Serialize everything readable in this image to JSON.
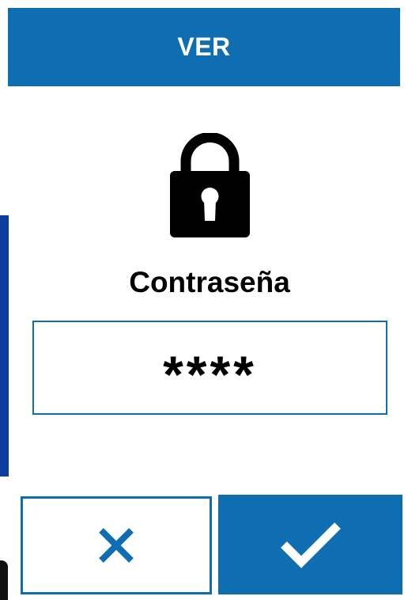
{
  "header": {
    "title": "VER"
  },
  "lock": {
    "icon": "lock-icon"
  },
  "password": {
    "label": "Contraseña",
    "value": "****"
  },
  "actions": {
    "cancel_icon": "close-icon",
    "confirm_icon": "checkmark-icon"
  },
  "colors": {
    "primary": "#0f6db2",
    "text": "#000000",
    "background": "#ffffff"
  }
}
